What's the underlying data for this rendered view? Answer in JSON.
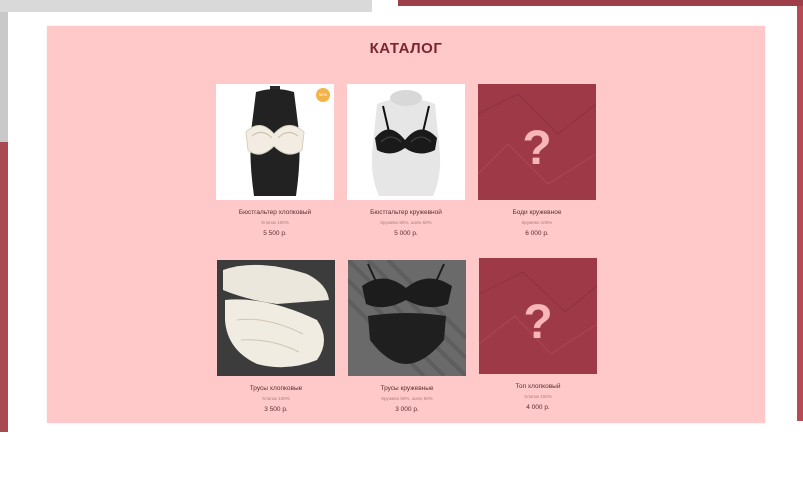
{
  "catalog": {
    "title": "КАТАЛОГ",
    "items": [
      {
        "name": "Бюстгальтер хлопковый",
        "composition": "Хлопок 100%",
        "price": "5 500 р.",
        "badge": "NEW",
        "image": "cotton-bra-photo"
      },
      {
        "name": "Бюстгальтер кружевной",
        "composition": "Кружево 50%, шелк 50%",
        "price": "5 000 р.",
        "badge": "",
        "image": "lace-bra-photo"
      },
      {
        "name": "Боди кружевное",
        "composition": "Кружево 100%",
        "price": "6 000 р.",
        "badge": "",
        "image": "question-placeholder"
      },
      {
        "name": "Трусы хлопковые",
        "composition": "Хлопок 100%",
        "price": "3 500 р.",
        "badge": "",
        "image": "cotton-briefs-photo"
      },
      {
        "name": "Трусы кружевные",
        "composition": "Кружево 50%, шелк 50%",
        "price": "3 000 р.",
        "badge": "",
        "image": "lace-set-photo"
      },
      {
        "name": "Топ хлопковый",
        "composition": "Хлопок 100%",
        "price": "4 000 р.",
        "badge": "",
        "image": "question-placeholder"
      }
    ]
  },
  "colors": {
    "panel": "#ffc9ca",
    "title": "#7a2630",
    "placeholder": "#9e3a48",
    "question_mark": "#f7b6b9",
    "badge": "#f4b24a"
  }
}
